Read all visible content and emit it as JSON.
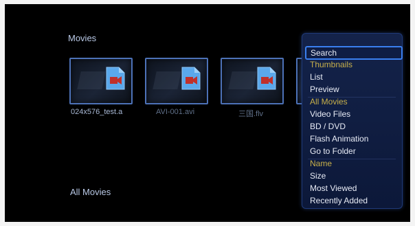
{
  "section_title": "Movies",
  "footer_label": "All Movies",
  "thumbnails": [
    {
      "caption": "024x576_test.a",
      "icon": "video-file-icon"
    },
    {
      "caption": "AVI-001.avi",
      "icon": "video-file-icon"
    },
    {
      "caption": "三国.flv",
      "icon": "video-file-icon"
    }
  ],
  "menu": {
    "items": [
      {
        "label": "Search",
        "state": "selected"
      },
      {
        "label": "Thumbnails",
        "state": "active"
      },
      {
        "label": "List",
        "state": "normal"
      },
      {
        "label": "Preview",
        "state": "normal"
      },
      {
        "label": "All Movies",
        "state": "active"
      },
      {
        "label": "Video Files",
        "state": "normal"
      },
      {
        "label": "BD / DVD",
        "state": "normal"
      },
      {
        "label": "Flash Animation",
        "state": "normal"
      },
      {
        "label": "Go to Folder",
        "state": "normal"
      },
      {
        "label": "Name",
        "state": "active"
      },
      {
        "label": "Size",
        "state": "normal"
      },
      {
        "label": "Most Viewed",
        "state": "normal"
      },
      {
        "label": "Recently Added",
        "state": "normal"
      }
    ]
  },
  "colors": {
    "selection_border": "#3a7ff0",
    "active_item": "#c8b04a",
    "thumb_border": "#4d72b8",
    "file_icon": "#5aa8ec",
    "play_icon": "#c0302a"
  }
}
